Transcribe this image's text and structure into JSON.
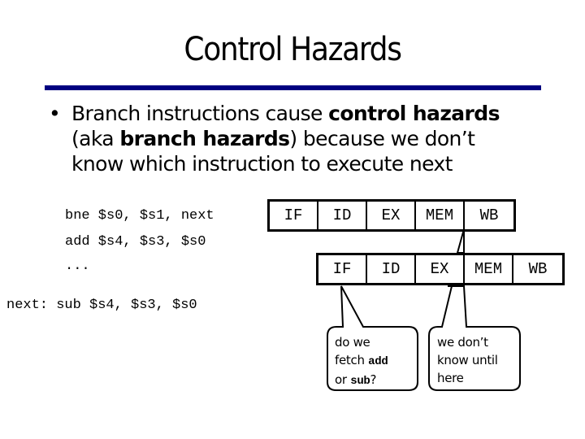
{
  "slide": {
    "title": "Control Hazards",
    "accent_color": "#000080"
  },
  "bullet": {
    "marker": "•",
    "line1_pre": "Branch instructions cause ",
    "line1_bold": "control hazards",
    "line2_pre": "(aka ",
    "line2_bold": "branch hazards",
    "line2_post": ") because we don’t",
    "line3": "know which instruction to execute next"
  },
  "code": {
    "lines": [
      "bne $s0, $s1, next",
      "add $s4, $s3, $s0",
      "...",
      "next: sub $s4, $s3, $s0"
    ]
  },
  "pipeline": {
    "row1": [
      "IF",
      "ID",
      "EX",
      "MEM",
      "WB"
    ],
    "row2": [
      "IF",
      "ID",
      "EX",
      "MEM",
      "WB"
    ]
  },
  "callouts": {
    "left": {
      "line1": "do we",
      "line2_pre": "fetch ",
      "line2_code": "add",
      "line3_pre": "or ",
      "line3_code": "sub",
      "line3_post": "?"
    },
    "right": {
      "line1": "we don’t",
      "line2": "know until",
      "line3": "here"
    }
  }
}
